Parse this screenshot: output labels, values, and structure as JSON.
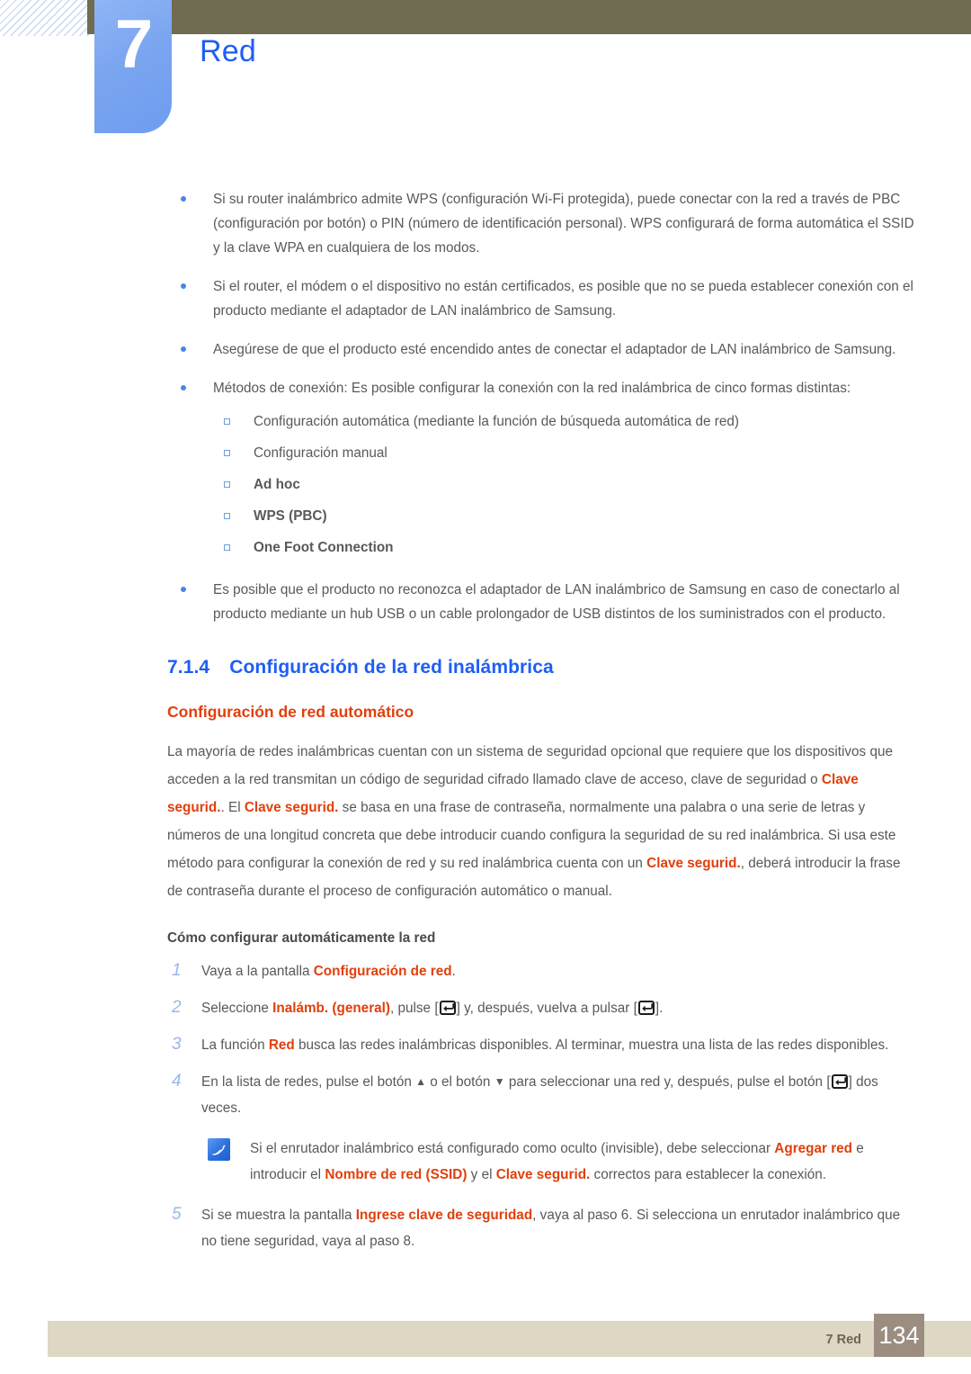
{
  "header": {
    "chapter_number": "7",
    "chapter_title": "Red",
    "olive_bar_color": "#706c52",
    "tab_color": "#7aa5f0",
    "title_color": "#1f5ef5"
  },
  "bullets": [
    "Si su router inalámbrico admite WPS (configuración Wi-Fi protegida), puede conectar con la red a través de PBC (configuración por botón) o PIN (número de identificación personal). WPS configurará de forma automática el SSID y la clave WPA en cualquiera de los modos.",
    "Si el router, el módem o el dispositivo no están certificados, es posible que no se pueda establecer conexión con el producto mediante el adaptador de LAN inalámbrico de Samsung.",
    "Asegúrese de que el producto esté encendido antes de conectar el adaptador de LAN inalámbrico de Samsung.",
    "Métodos de conexión: Es posible configurar la conexión con la red inalámbrica de cinco formas distintas:",
    "Es posible que el producto no reconozca el adaptador de LAN inalámbrico de Samsung en caso de conectarlo al producto mediante un hub USB o un cable prolongador de USB distintos de los suministrados con el producto."
  ],
  "methods": [
    {
      "label": "Configuración automática (mediante la función de búsqueda automática de red)",
      "highlight": false
    },
    {
      "label": "Configuración manual",
      "highlight": false
    },
    {
      "label": "Ad hoc",
      "highlight": true
    },
    {
      "label": "WPS (PBC)",
      "highlight": true
    },
    {
      "label": "One Foot Connection",
      "highlight": true
    }
  ],
  "section": {
    "number": "7.1.4",
    "title": "Configuración de la red inalámbrica",
    "subtitle": "Configuración de red automático"
  },
  "paragraph": {
    "p1": "La mayoría de redes inalámbricas cuentan con un sistema de seguridad opcional que requiere que los dispositivos que acceden a la red transmitan un código de seguridad cifrado llamado clave de acceso, clave de seguridad o ",
    "term1": "Clave segurid.",
    "p2": ". El ",
    "term2": "Clave segurid.",
    "p3": " se basa en una frase de contraseña, normalmente una palabra o una serie de letras y números de una longitud concreta que debe introducir cuando configura la seguridad de su red inalámbrica. Si usa este método para configurar la conexión de red y su red inalámbrica cuenta con un ",
    "term3": "Clave segurid.",
    "p4": ", deberá introducir la frase de contraseña durante el proceso de configuración automático o manual."
  },
  "steps_heading": "Cómo configurar automáticamente la red",
  "steps": {
    "s1": {
      "num": "1",
      "a": "Vaya a la pantalla ",
      "t": "Configuración de red",
      "b": "."
    },
    "s2": {
      "num": "2",
      "a": "Seleccione ",
      "t": "Inalámb. (general)",
      "b": ", pulse [",
      "c": "] y, después, vuelva a pulsar [",
      "d": "]."
    },
    "s3": {
      "num": "3",
      "a": "La función ",
      "t": "Red",
      "b": " busca las redes inalámbricas disponibles. Al terminar, muestra una lista de las redes disponibles."
    },
    "s4": {
      "num": "4",
      "a": "En la lista de redes, pulse el botón ",
      "up": "▲",
      "b": " o el botón ",
      "down": "▼",
      "c": " para seleccionar una red y, después, pulse el botón [",
      "d": "] dos veces."
    },
    "s5": {
      "num": "5",
      "a": "Si se muestra la pantalla ",
      "t": "Ingrese clave de seguridad",
      "b": ", vaya al paso 6. Si selecciona un enrutador inalámbrico que no tiene seguridad, vaya al paso 8."
    }
  },
  "note": {
    "a": "Si el enrutador inalámbrico está configurado como oculto (invisible), debe seleccionar ",
    "t1": "Agregar red",
    "b": " e introducir el ",
    "t2": "Nombre de red (SSID)",
    "c": " y el ",
    "t3": "Clave segurid.",
    "d": " correctos para establecer la conexión."
  },
  "footer": {
    "label": "7 Red",
    "page_number": "134",
    "band_color": "#ddd7c4",
    "page_box_color": "#9c8d81"
  },
  "colors": {
    "highlight": "#e0400c",
    "heading_blue": "#1f5ef5",
    "body_gray": "#59595c",
    "step_number": "#9ab7e8"
  }
}
